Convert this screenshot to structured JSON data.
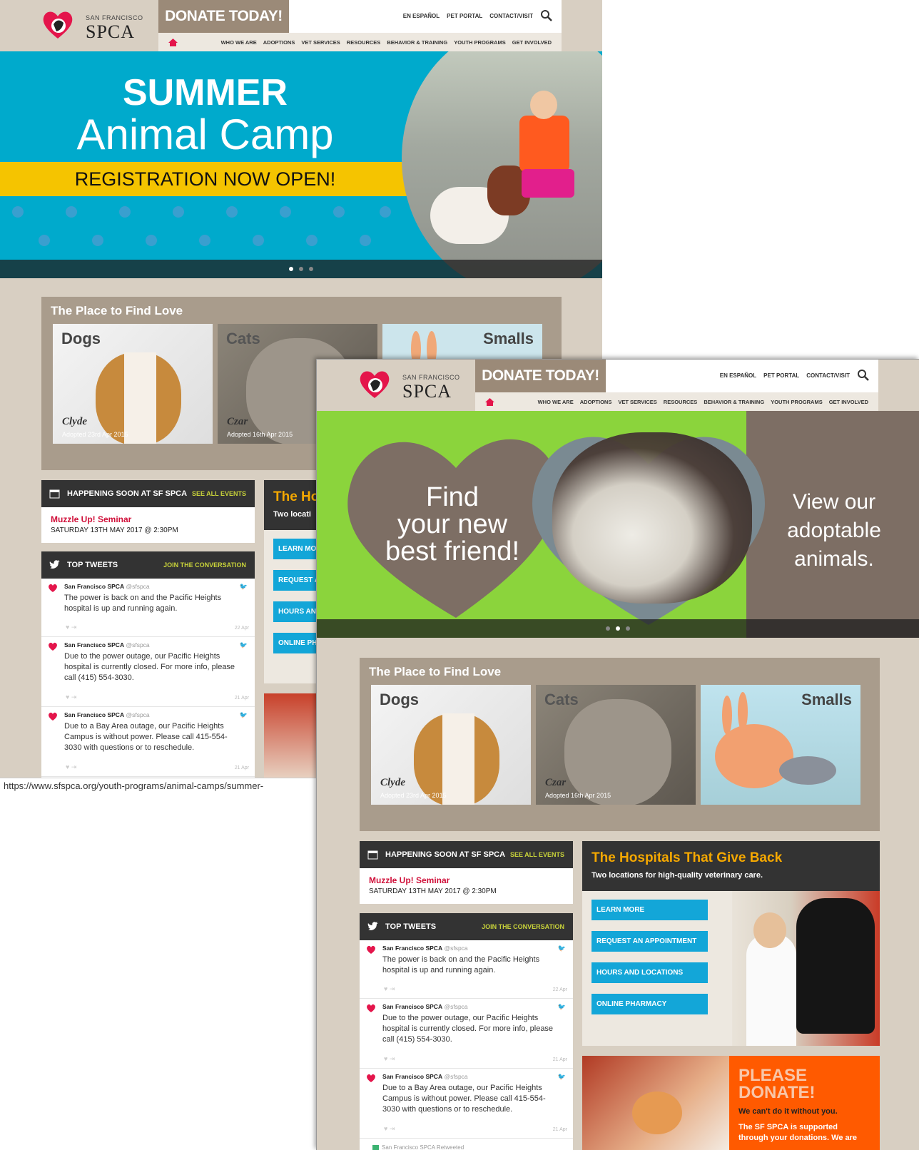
{
  "header": {
    "logo_small": "SAN FRANCISCO",
    "logo_big": "SPCA",
    "donate_label": "DONATE TODAY!",
    "util_links": [
      "EN ESPAÑOL",
      "PET PORTAL",
      "CONTACT/VISIT"
    ],
    "nav_items": [
      "WHO WE ARE",
      "ADOPTIONS",
      "VET SERVICES",
      "RESOURCES",
      "BEHAVIOR & TRAINING",
      "YOUTH PROGRAMS",
      "GET INVOLVED"
    ]
  },
  "hero1": {
    "line1": "SUMMER",
    "line2": "Animal Camp",
    "banner": "REGISTRATION NOW OPEN!",
    "colors": {
      "bg": "#00aacc",
      "banner": "#f5c400"
    }
  },
  "hero2": {
    "left_text": [
      "Find",
      "your new",
      "best friend!"
    ],
    "right_text": [
      "View our",
      "adoptable",
      "animals."
    ],
    "colors": {
      "green": "#8bd43c",
      "brown": "#7d6e64"
    }
  },
  "love": {
    "title": "The Place to Find Love",
    "tiles": [
      {
        "label": "Dogs",
        "name": "Clyde",
        "adopted": "Adopted 23rd Apr 2015"
      },
      {
        "label": "Cats",
        "name": "Czar",
        "adopted": "Adopted 16th Apr 2015"
      },
      {
        "label": "Smalls"
      }
    ]
  },
  "events": {
    "title": "HAPPENING SOON AT SF SPCA",
    "link": "SEE ALL EVENTS",
    "event_name": "Muzzle Up! Seminar",
    "event_date": "SATURDAY 13TH MAY 2017 @ 2:30PM"
  },
  "tweets": {
    "title": "TOP TWEETS",
    "link": "JOIN THE CONVERSATION",
    "author": "San Francisco SPCA",
    "handle": "@sfspca",
    "items": [
      {
        "text": "The power is back on and the Pacific Heights hospital is up and running again.",
        "date": "22 Apr"
      },
      {
        "text": "Due to the power outage, our Pacific Heights hospital is currently closed. For more info, please call (415) 554-3030.",
        "date": "21 Apr"
      },
      {
        "text": "Due to a Bay Area outage, our Pacific Heights Campus is without power. Please call 415-554-3030 with questions or to reschedule.",
        "date": "21 Apr"
      }
    ],
    "retweeted": "San Francisco SPCA Retweeted"
  },
  "hospitals": {
    "title": "The Hospitals That Give Back",
    "title_cropped": "The Ho",
    "subtitle": "Two locations for high-quality veterinary care.",
    "subtitle_cropped": "Two locati",
    "buttons": [
      "LEARN MORE",
      "REQUEST AN APPOINTMENT",
      "HOURS AND LOCATIONS",
      "ONLINE PHARMACY"
    ],
    "buttons_cropped": [
      "LEARN MO",
      "REQUEST A",
      "HOURS AN",
      "ONLINE PH"
    ]
  },
  "donate_box": {
    "title1": "PLEASE",
    "title2": "DONATE!",
    "line1": "We can't do it without you.",
    "line2": "The SF SPCA is supported",
    "line3": "through your donations. We are"
  },
  "status_url": "https://www.sfspca.org/youth-programs/animal-camps/summer-"
}
